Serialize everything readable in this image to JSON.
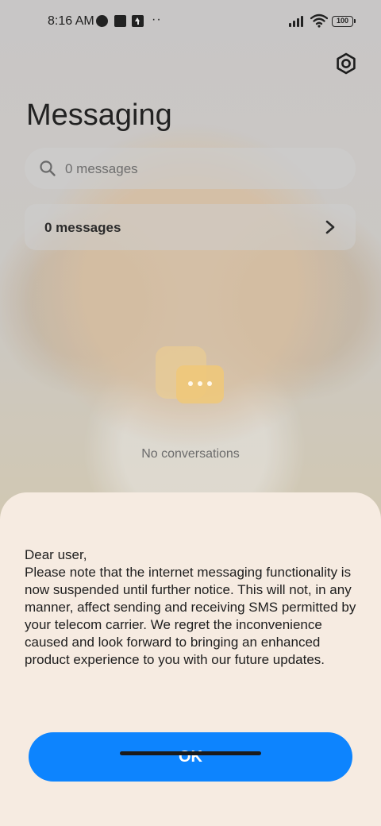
{
  "status_bar": {
    "time": "8:16 AM",
    "battery": "100",
    "icons": [
      "app-notification-icon",
      "square-notification-icon",
      "upload-icon",
      "more-dots-icon",
      "signal-icon",
      "wifi-icon",
      "battery-icon"
    ]
  },
  "header": {
    "title": "Messaging",
    "settings_icon": "settings-icon"
  },
  "search": {
    "placeholder": "0 messages",
    "icon": "search-icon"
  },
  "messages_card": {
    "label": "0 messages",
    "icon": "chevron-right-icon"
  },
  "empty_state": {
    "text": "No conversations",
    "icon": "chat-bubbles-icon"
  },
  "dialog": {
    "greeting": "Dear user,",
    "message": "Please note that the internet messaging functionality is now suspended until further notice. This will not, in any manner, affect sending and receiving SMS permitted by your telecom carrier. We regret the inconvenience caused and look forward to bringing an enhanced product experience to you with our future updates.",
    "ok_label": "OK"
  },
  "colors": {
    "accent": "#0d84fe",
    "sheet_background": "#f6ebe1"
  }
}
